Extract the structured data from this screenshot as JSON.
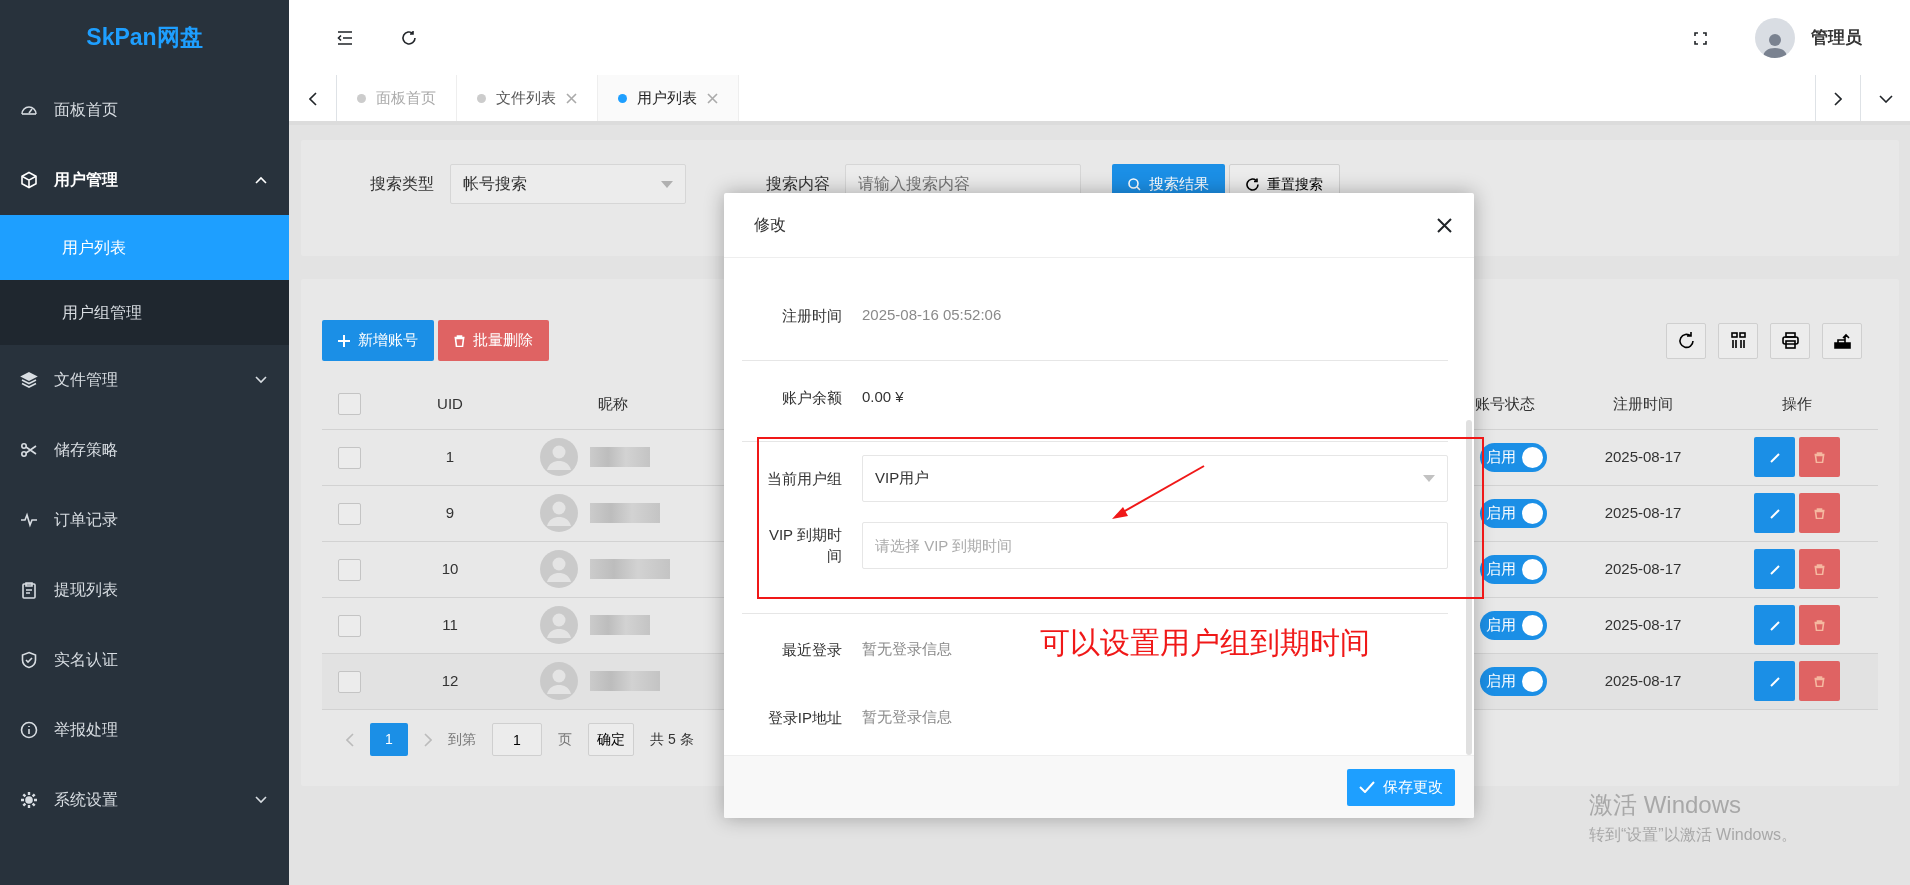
{
  "sidebar": {
    "logo": "SkPan网盘",
    "items": [
      {
        "kind": "link",
        "label": "面板首页",
        "selected": false
      },
      {
        "kind": "group",
        "label": "用户管理",
        "selected": false,
        "expanded": true,
        "children": [
          {
            "label": "用户列表",
            "selected": true
          },
          {
            "label": "用户组管理",
            "selected": false
          }
        ]
      },
      {
        "kind": "group",
        "label": "文件管理",
        "selected": false,
        "expanded": false
      },
      {
        "kind": "link",
        "label": "储存策略",
        "selected": false
      },
      {
        "kind": "link",
        "label": "订单记录",
        "selected": false
      },
      {
        "kind": "link",
        "label": "提现列表",
        "selected": false
      },
      {
        "kind": "link",
        "label": "实名认证",
        "selected": false
      },
      {
        "kind": "link",
        "label": "举报处理",
        "selected": false
      },
      {
        "kind": "group",
        "label": "系统设置",
        "selected": false,
        "expanded": false
      }
    ]
  },
  "header": {
    "user": "管理员"
  },
  "tabs": [
    {
      "label": "面板首页",
      "closable": false,
      "selected": false
    },
    {
      "label": "文件列表",
      "closable": true,
      "selected": false
    },
    {
      "label": "用户列表",
      "closable": true,
      "selected": true
    }
  ],
  "search": {
    "type_label": "搜索类型",
    "type_value": "帐号搜索",
    "content_label": "搜索内容",
    "content_placeholder": "请输入搜索内容",
    "search_button": "搜索结果",
    "reset_button": "重置搜索"
  },
  "actions": {
    "add": "新增账号",
    "delete": "批量删除"
  },
  "table": {
    "select_all": {
      "checked": false
    },
    "columns": [
      "UID",
      "昵称",
      "账号状态",
      "注册时间",
      "操作"
    ],
    "rows": [
      {
        "checked": false,
        "uid": "1",
        "status": "启用",
        "on": true,
        "registered": "2025-08-17"
      },
      {
        "checked": false,
        "uid": "9",
        "status": "启用",
        "on": true,
        "registered": "2025-08-17"
      },
      {
        "checked": false,
        "uid": "10",
        "status": "启用",
        "on": true,
        "registered": "2025-08-17"
      },
      {
        "checked": false,
        "uid": "11",
        "status": "启用",
        "on": true,
        "registered": "2025-08-17"
      },
      {
        "checked": false,
        "uid": "12",
        "status": "启用",
        "on": true,
        "registered": "2025-08-17"
      }
    ]
  },
  "pagination": {
    "pages": [
      {
        "label": "1",
        "selected": true
      }
    ],
    "goto_label": "到第",
    "goto_value": "1",
    "page_unit": "页",
    "confirm": "确定",
    "total": "共 5 条"
  },
  "modal": {
    "title": "修改",
    "sections": [
      [
        {
          "kind": "text",
          "label": "注册时间",
          "value": "2025-08-16 05:52:06",
          "muted": true
        }
      ],
      [
        {
          "kind": "text",
          "label": "账户余额",
          "value": "0.00 ¥",
          "muted": false
        }
      ],
      [
        {
          "kind": "select",
          "label": "当前用户组",
          "value": "VIP用户"
        },
        {
          "kind": "input",
          "label": "VIP 到期时间",
          "placeholder": "请选择 VIP 到期时间"
        }
      ],
      [
        {
          "kind": "text",
          "label": "最近登录",
          "value": "暂无登录信息",
          "muted": true
        },
        {
          "kind": "text",
          "label": "登录IP地址",
          "value": "暂无登录信息",
          "muted": true
        }
      ]
    ],
    "save_button": "保存更改"
  },
  "annotation": {
    "text": "可以设置用户组到期时间"
  },
  "os_notice": {
    "title": "激活 Windows",
    "subtitle": "转到“设置”以激活 Windows。"
  }
}
